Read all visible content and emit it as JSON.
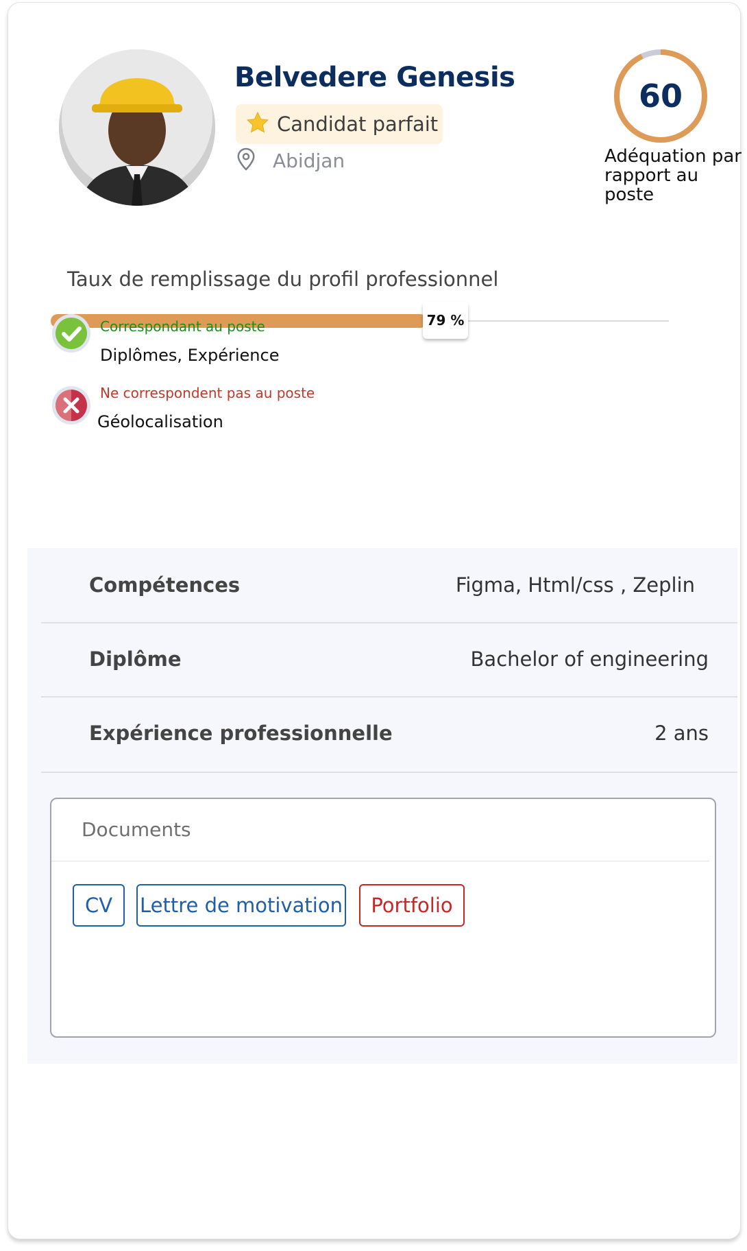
{
  "candidate": {
    "name": "Belvedere Genesis",
    "badge": "Candidat parfait",
    "location": "Abidjan"
  },
  "score": {
    "value": "60",
    "fraction": 0.93,
    "label": "Adéquation par rapport au poste"
  },
  "profile_fill": {
    "title": "Taux de remplissage du profil professionnel",
    "percent": 79,
    "percent_label": "79 %"
  },
  "matching": {
    "label": "Correspondant au poste",
    "value": "Diplômes, Expérience"
  },
  "not_matching": {
    "label": "Ne correspondent pas au poste",
    "value": "Géolocalisation"
  },
  "details": [
    {
      "key": "Compétences",
      "value": "Figma, Html/css , Zeplin"
    },
    {
      "key": "Diplôme",
      "value": "Bachelor of engineering"
    },
    {
      "key": "Expérience professionnelle",
      "value": "2 ans"
    }
  ],
  "documents": {
    "title": "Documents",
    "items": [
      "CV",
      "Lettre de motivation",
      "Portfolio"
    ]
  },
  "colors": {
    "accent": "#de9a57",
    "title": "#0b2e5e",
    "match_green": "#1a8f1a",
    "mismatch_red": "#c0392b",
    "doc_blue": "#1f5fa8",
    "doc_red": "#c62828"
  }
}
